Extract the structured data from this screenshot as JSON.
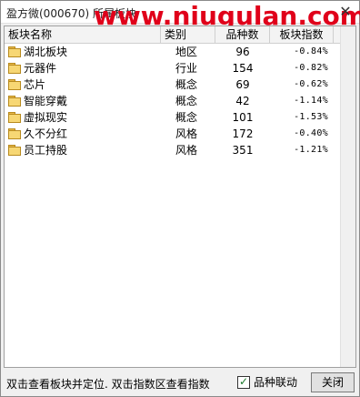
{
  "window": {
    "title": "盈方微(000670)  所属板块",
    "watermark": "www.niugulan.com",
    "close_glyph": "✕"
  },
  "table": {
    "headers": [
      "板块名称",
      "类别",
      "品种数",
      "板块指数"
    ],
    "rows": [
      {
        "name": "湖北板块",
        "type": "地区",
        "count": "96",
        "index": "-0.84%"
      },
      {
        "name": "元器件",
        "type": "行业",
        "count": "154",
        "index": "-0.82%"
      },
      {
        "name": "芯片",
        "type": "概念",
        "count": "69",
        "index": "-0.62%"
      },
      {
        "name": "智能穿戴",
        "type": "概念",
        "count": "42",
        "index": "-1.14%"
      },
      {
        "name": "虚拟现实",
        "type": "概念",
        "count": "101",
        "index": "-1.53%"
      },
      {
        "name": "久不分红",
        "type": "风格",
        "count": "172",
        "index": "-0.40%"
      },
      {
        "name": "员工持股",
        "type": "风格",
        "count": "351",
        "index": "-1.21%"
      }
    ]
  },
  "footer": {
    "hint": "双击查看板块并定位. 双击指数区查看指数",
    "linkage_label": "品种联动",
    "linkage_checked": true,
    "close_label": "关闭"
  },
  "colors": {
    "watermark": "#e0001a",
    "folder": "#f7d774"
  },
  "icons": {
    "row_icon": "folder-icon",
    "close_icon": "close-icon"
  }
}
